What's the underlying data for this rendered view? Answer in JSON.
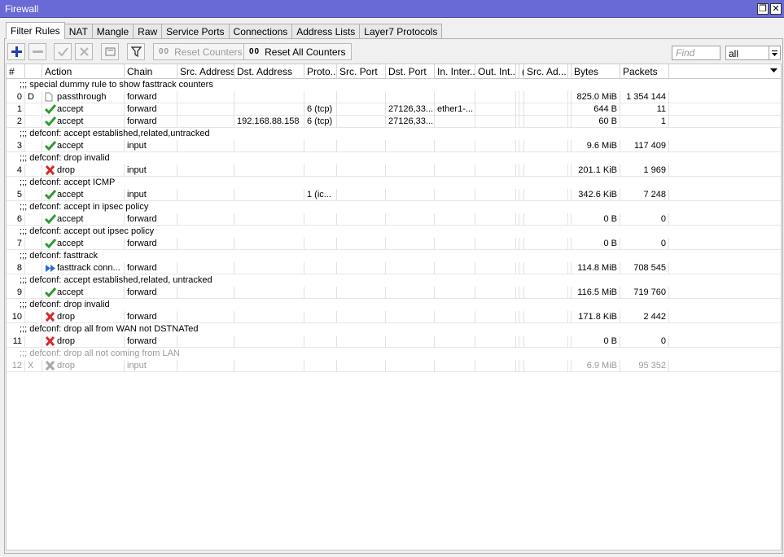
{
  "window": {
    "title": "Firewall",
    "restore_label": "❐",
    "close_label": "✕"
  },
  "tabs": [
    {
      "label": "Filter Rules",
      "active": true
    },
    {
      "label": "NAT"
    },
    {
      "label": "Mangle"
    },
    {
      "label": "Raw"
    },
    {
      "label": "Service Ports"
    },
    {
      "label": "Connections"
    },
    {
      "label": "Address Lists"
    },
    {
      "label": "Layer7 Protocols"
    }
  ],
  "toolbar": {
    "reset_counters_label": "Reset Counters",
    "reset_all_counters_label": "Reset All Counters",
    "counter_glyph": "00",
    "find_placeholder": "Find",
    "filter_value": "all"
  },
  "columns": [
    "#",
    "",
    "Action",
    "Chain",
    "Src. Address",
    "Dst. Address",
    "Proto...",
    "Src. Port",
    "Dst. Port",
    "In. Inter...",
    "Out. Int...",
    "I",
    "(",
    "Src. Ad...",
    "I",
    "Bytes",
    "Packets"
  ],
  "rows": [
    {
      "type": "comment",
      "text": ";;; special dummy rule to show fasttrack counters"
    },
    {
      "type": "rule",
      "num": "0",
      "flag": "D",
      "icon": "passthrough-icon",
      "action": "passthrough",
      "chain": "forward",
      "src": "",
      "dst": "",
      "proto": "",
      "sport": "",
      "dport": "",
      "in": "",
      "out": "",
      "bytes": "825.0 MiB",
      "packets": "1 354 144"
    },
    {
      "type": "rule",
      "num": "1",
      "flag": "",
      "icon": "accept-icon",
      "action": "accept",
      "chain": "forward",
      "src": "",
      "dst": "",
      "proto": "6 (tcp)",
      "sport": "",
      "dport": "27126,33...",
      "in": "ether1-...",
      "out": "",
      "bytes": "644 B",
      "packets": "11"
    },
    {
      "type": "rule",
      "num": "2",
      "flag": "",
      "icon": "accept-icon",
      "action": "accept",
      "chain": "forward",
      "src": "",
      "dst": "192.168.88.158",
      "proto": "6 (tcp)",
      "sport": "",
      "dport": "27126,33...",
      "in": "",
      "out": "",
      "bytes": "60 B",
      "packets": "1"
    },
    {
      "type": "comment",
      "text": ";;; defconf: accept established,related,untracked"
    },
    {
      "type": "rule",
      "num": "3",
      "flag": "",
      "icon": "accept-icon",
      "action": "accept",
      "chain": "input",
      "src": "",
      "dst": "",
      "proto": "",
      "sport": "",
      "dport": "",
      "in": "",
      "out": "",
      "bytes": "9.6 MiB",
      "packets": "117 409"
    },
    {
      "type": "comment",
      "text": ";;; defconf: drop invalid"
    },
    {
      "type": "rule",
      "num": "4",
      "flag": "",
      "icon": "drop-icon",
      "action": "drop",
      "chain": "input",
      "src": "",
      "dst": "",
      "proto": "",
      "sport": "",
      "dport": "",
      "in": "",
      "out": "",
      "bytes": "201.1 KiB",
      "packets": "1 969"
    },
    {
      "type": "comment",
      "text": ";;; defconf: accept ICMP"
    },
    {
      "type": "rule",
      "num": "5",
      "flag": "",
      "icon": "accept-icon",
      "action": "accept",
      "chain": "input",
      "src": "",
      "dst": "",
      "proto": "1 (ic...",
      "sport": "",
      "dport": "",
      "in": "",
      "out": "",
      "bytes": "342.6 KiB",
      "packets": "7 248"
    },
    {
      "type": "comment",
      "text": ";;; defconf: accept in ipsec policy"
    },
    {
      "type": "rule",
      "num": "6",
      "flag": "",
      "icon": "accept-icon",
      "action": "accept",
      "chain": "forward",
      "src": "",
      "dst": "",
      "proto": "",
      "sport": "",
      "dport": "",
      "in": "",
      "out": "",
      "bytes": "0 B",
      "packets": "0"
    },
    {
      "type": "comment",
      "text": ";;; defconf: accept out ipsec policy"
    },
    {
      "type": "rule",
      "num": "7",
      "flag": "",
      "icon": "accept-icon",
      "action": "accept",
      "chain": "forward",
      "src": "",
      "dst": "",
      "proto": "",
      "sport": "",
      "dport": "",
      "in": "",
      "out": "",
      "bytes": "0 B",
      "packets": "0"
    },
    {
      "type": "comment",
      "text": ";;; defconf: fasttrack"
    },
    {
      "type": "rule",
      "num": "8",
      "flag": "",
      "icon": "fasttrack-icon",
      "action": "fasttrack conn...",
      "chain": "forward",
      "src": "",
      "dst": "",
      "proto": "",
      "sport": "",
      "dport": "",
      "in": "",
      "out": "",
      "bytes": "114.8 MiB",
      "packets": "708 545"
    },
    {
      "type": "comment",
      "text": ";;; defconf: accept established,related, untracked"
    },
    {
      "type": "rule",
      "num": "9",
      "flag": "",
      "icon": "accept-icon",
      "action": "accept",
      "chain": "forward",
      "src": "",
      "dst": "",
      "proto": "",
      "sport": "",
      "dport": "",
      "in": "",
      "out": "",
      "bytes": "116.5 MiB",
      "packets": "719 760"
    },
    {
      "type": "comment",
      "text": ";;; defconf: drop invalid"
    },
    {
      "type": "rule",
      "num": "10",
      "flag": "",
      "icon": "drop-icon",
      "action": "drop",
      "chain": "forward",
      "src": "",
      "dst": "",
      "proto": "",
      "sport": "",
      "dport": "",
      "in": "",
      "out": "",
      "bytes": "171.8 KiB",
      "packets": "2 442"
    },
    {
      "type": "comment",
      "text": ";;; defconf:  drop all from WAN not DSTNATed"
    },
    {
      "type": "rule",
      "num": "11",
      "flag": "",
      "icon": "drop-icon",
      "action": "drop",
      "chain": "forward",
      "src": "",
      "dst": "",
      "proto": "",
      "sport": "",
      "dport": "",
      "in": "",
      "out": "",
      "bytes": "0 B",
      "packets": "0"
    },
    {
      "type": "comment",
      "text": ";;; defconf: drop all not coming from LAN",
      "disabled": true
    },
    {
      "type": "rule",
      "num": "12",
      "flag": "X",
      "icon": "drop-icon",
      "action": "drop",
      "chain": "input",
      "src": "",
      "dst": "",
      "proto": "",
      "sport": "",
      "dport": "",
      "in": "",
      "out": "",
      "bytes": "6.9 MiB",
      "packets": "95 352",
      "disabled": true
    }
  ],
  "colors": {
    "titlebar": "#6a6ad6",
    "accept": "#2e9b2e",
    "drop": "#d42a2a",
    "fasttrack": "#2a6ad4"
  }
}
